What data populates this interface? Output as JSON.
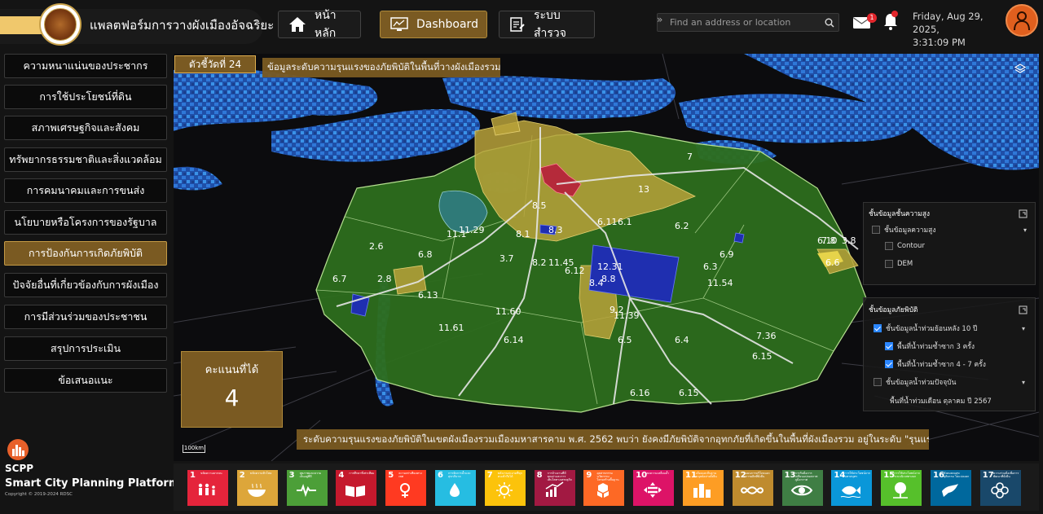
{
  "header": {
    "platform_title": "แพลตฟอร์มการวางผังเมืองอัจฉริยะ",
    "nav": [
      {
        "label": "หน้าหลัก",
        "icon": "home-icon",
        "active": false
      },
      {
        "label": "Dashboard",
        "icon": "dashboard-icon",
        "active": true
      },
      {
        "label": "ระบบสำรวจ",
        "icon": "survey-icon",
        "active": false
      }
    ],
    "search_placeholder": "Find an address or location",
    "mail_badge": "1",
    "date": "Friday, Aug 29, 2025,",
    "time": "3:31:09 PM"
  },
  "sidebar": {
    "items": [
      {
        "label": "ความหนาแน่นของประชากร",
        "active": false
      },
      {
        "label": "การใช้ประโยชน์ที่ดิน",
        "active": false
      },
      {
        "label": "สภาพเศรษฐกิจและสังคม",
        "active": false
      },
      {
        "label": "ทรัพยากรธรรมชาติและสิ่งแวดล้อม",
        "active": false
      },
      {
        "label": "การคมนาคมและการขนส่ง",
        "active": false
      },
      {
        "label": "นโยบายหรือโครงการของรัฐบาล",
        "active": false
      },
      {
        "label": "การป้องกันการเกิดภัยพิบัติ",
        "active": true
      },
      {
        "label": "ปัจจัยอื่นที่เกี่ยวข้องกับการผังเมือง",
        "active": false
      },
      {
        "label": "การมีส่วนร่วมของประชาชน",
        "active": false
      },
      {
        "label": "สรุปการประเมิน",
        "active": false
      },
      {
        "label": "ข้อเสนอแนะ",
        "active": false
      }
    ],
    "brand_short": "SCPP",
    "brand_full": "Smart City Planning Platform",
    "copyright": "Copyright © 2019-2024 RDSC"
  },
  "map": {
    "indicator_tag": "ตัวชี้วัดที่ 24",
    "title": "ข้อมูลระดับความรุนแรงของภัยพิบัติในพื้นที่วางผังเมืองรวม",
    "score_label": "คะแนนที่ได้",
    "score_value": "4",
    "summary": "ระดับความรุนแรงของภัยพิบัติในเขตผังเมืองรวมเมืองมหาสารคาม พ.ศ. 2562 พบว่า ยังคงมีภัยพิบัติจากอุทกภัยที่เกิดขึ้นในพื้นที่ผังเมืองรวม อยู่ในระดับ \"รุนแรงน้อย\"",
    "scale_label": "100km",
    "zone_labels": [
      "6.1",
      "6.2",
      "6.3",
      "6.4",
      "6.5",
      "6.6",
      "6.7",
      "6.8",
      "6.9",
      "6.10",
      "6.11",
      "6.12",
      "6.13",
      "6.14",
      "6.15",
      "6.16",
      "7",
      "7.8",
      "8.1",
      "8.2",
      "8.3",
      "8.4",
      "8.5",
      "8.8",
      "9.2",
      "11.1",
      "11.29",
      "11.39",
      "11.45",
      "11.54",
      "11.60",
      "11.61",
      "12.31",
      "13",
      "2.6",
      "2.8",
      "3.7",
      "3.8",
      "7.36",
      "6.15"
    ],
    "elevation_panel": {
      "title": "ชั้นข้อมูลชั้นความสูง",
      "group": "ชั้นข้อมูลความสูง",
      "items": [
        "Contour",
        "DEM"
      ]
    },
    "hazard_panel": {
      "title": "ชั้นข้อมูลภัยพิบัติ",
      "group1": "ชั้นข้อมูลน้ำท่วมย้อนหลัง 10 ปี",
      "items": [
        "พื้นที่น้ำท่วมซ้ำซาก 3 ครั้ง",
        "พื้นที่น้ำท่วมซ้ำซาก 4 - 7 ครั้ง"
      ],
      "group2": "ชั้นข้อมูลน้ำท่วมปัจจุบัน",
      "current_item": "พื้นที่น้ำท่วมเดือน ตุลาคม ปี 2567"
    }
  },
  "sdg": [
    {
      "num": "1",
      "text": "ขจัดความยากจน",
      "color": "#e5243b",
      "icon": "people-icon"
    },
    {
      "num": "2",
      "text": "ขจัดความหิวโหย",
      "color": "#dda63a",
      "icon": "bowl-icon"
    },
    {
      "num": "3",
      "text": "สุขภาพและความเป็นอยู่ที่ดี",
      "color": "#4c9f38",
      "icon": "heartbeat-icon"
    },
    {
      "num": "4",
      "text": "การศึกษาที่เท่าเทียม",
      "color": "#c5192d",
      "icon": "book-icon"
    },
    {
      "num": "5",
      "text": "ความเท่าเทียมทางเพศ",
      "color": "#ff3a21",
      "icon": "gender-icon"
    },
    {
      "num": "6",
      "text": "การจัดการน้ำและสุขาภิบาล",
      "color": "#26bde2",
      "icon": "water-icon"
    },
    {
      "num": "7",
      "text": "พลังงานสะอาดที่ทุกคนเข้าถึงได้",
      "color": "#fcc30b",
      "icon": "sun-icon"
    },
    {
      "num": "8",
      "text": "การจ้างงานที่มีคุณค่าและการเติบโตทางเศรษฐกิจ",
      "color": "#a21942",
      "icon": "growth-icon"
    },
    {
      "num": "9",
      "text": "อุตสาหกรรม นวัตกรรม โครงสร้างพื้นฐาน",
      "color": "#fd6925",
      "icon": "cubes-icon"
    },
    {
      "num": "10",
      "text": "ลดความเหลื่อมล้ำ",
      "color": "#dd1367",
      "icon": "equality-icon"
    },
    {
      "num": "11",
      "text": "เมืองและถิ่นฐานมนุษย์อย่างยั่งยืน",
      "color": "#fd9d24",
      "icon": "city-icon"
    },
    {
      "num": "12",
      "text": "แผนการบริโภคและการผลิตที่ยั่งยืน",
      "color": "#bf8b2e",
      "icon": "infinity-icon"
    },
    {
      "num": "13",
      "text": "การรับมือการเปลี่ยนแปลงสภาพภูมิอากาศ",
      "color": "#3f7e44",
      "icon": "eye-icon"
    },
    {
      "num": "14",
      "text": "การใช้ประโยชน์จากมหาสมุทร",
      "color": "#0a97d9",
      "icon": "fish-icon"
    },
    {
      "num": "15",
      "text": "การใช้ประโยชน์จากระบบนิเวศทางบก",
      "color": "#56c02b",
      "icon": "tree-icon"
    },
    {
      "num": "16",
      "text": "สังคมสงบสุข ยุติธรรม ไม่แบ่งแยก",
      "color": "#00689d",
      "icon": "dove-icon"
    },
    {
      "num": "17",
      "text": "ความร่วมมือเพื่อการพัฒนาที่ยั่งยืน",
      "color": "#19486a",
      "icon": "flower-icon"
    }
  ]
}
